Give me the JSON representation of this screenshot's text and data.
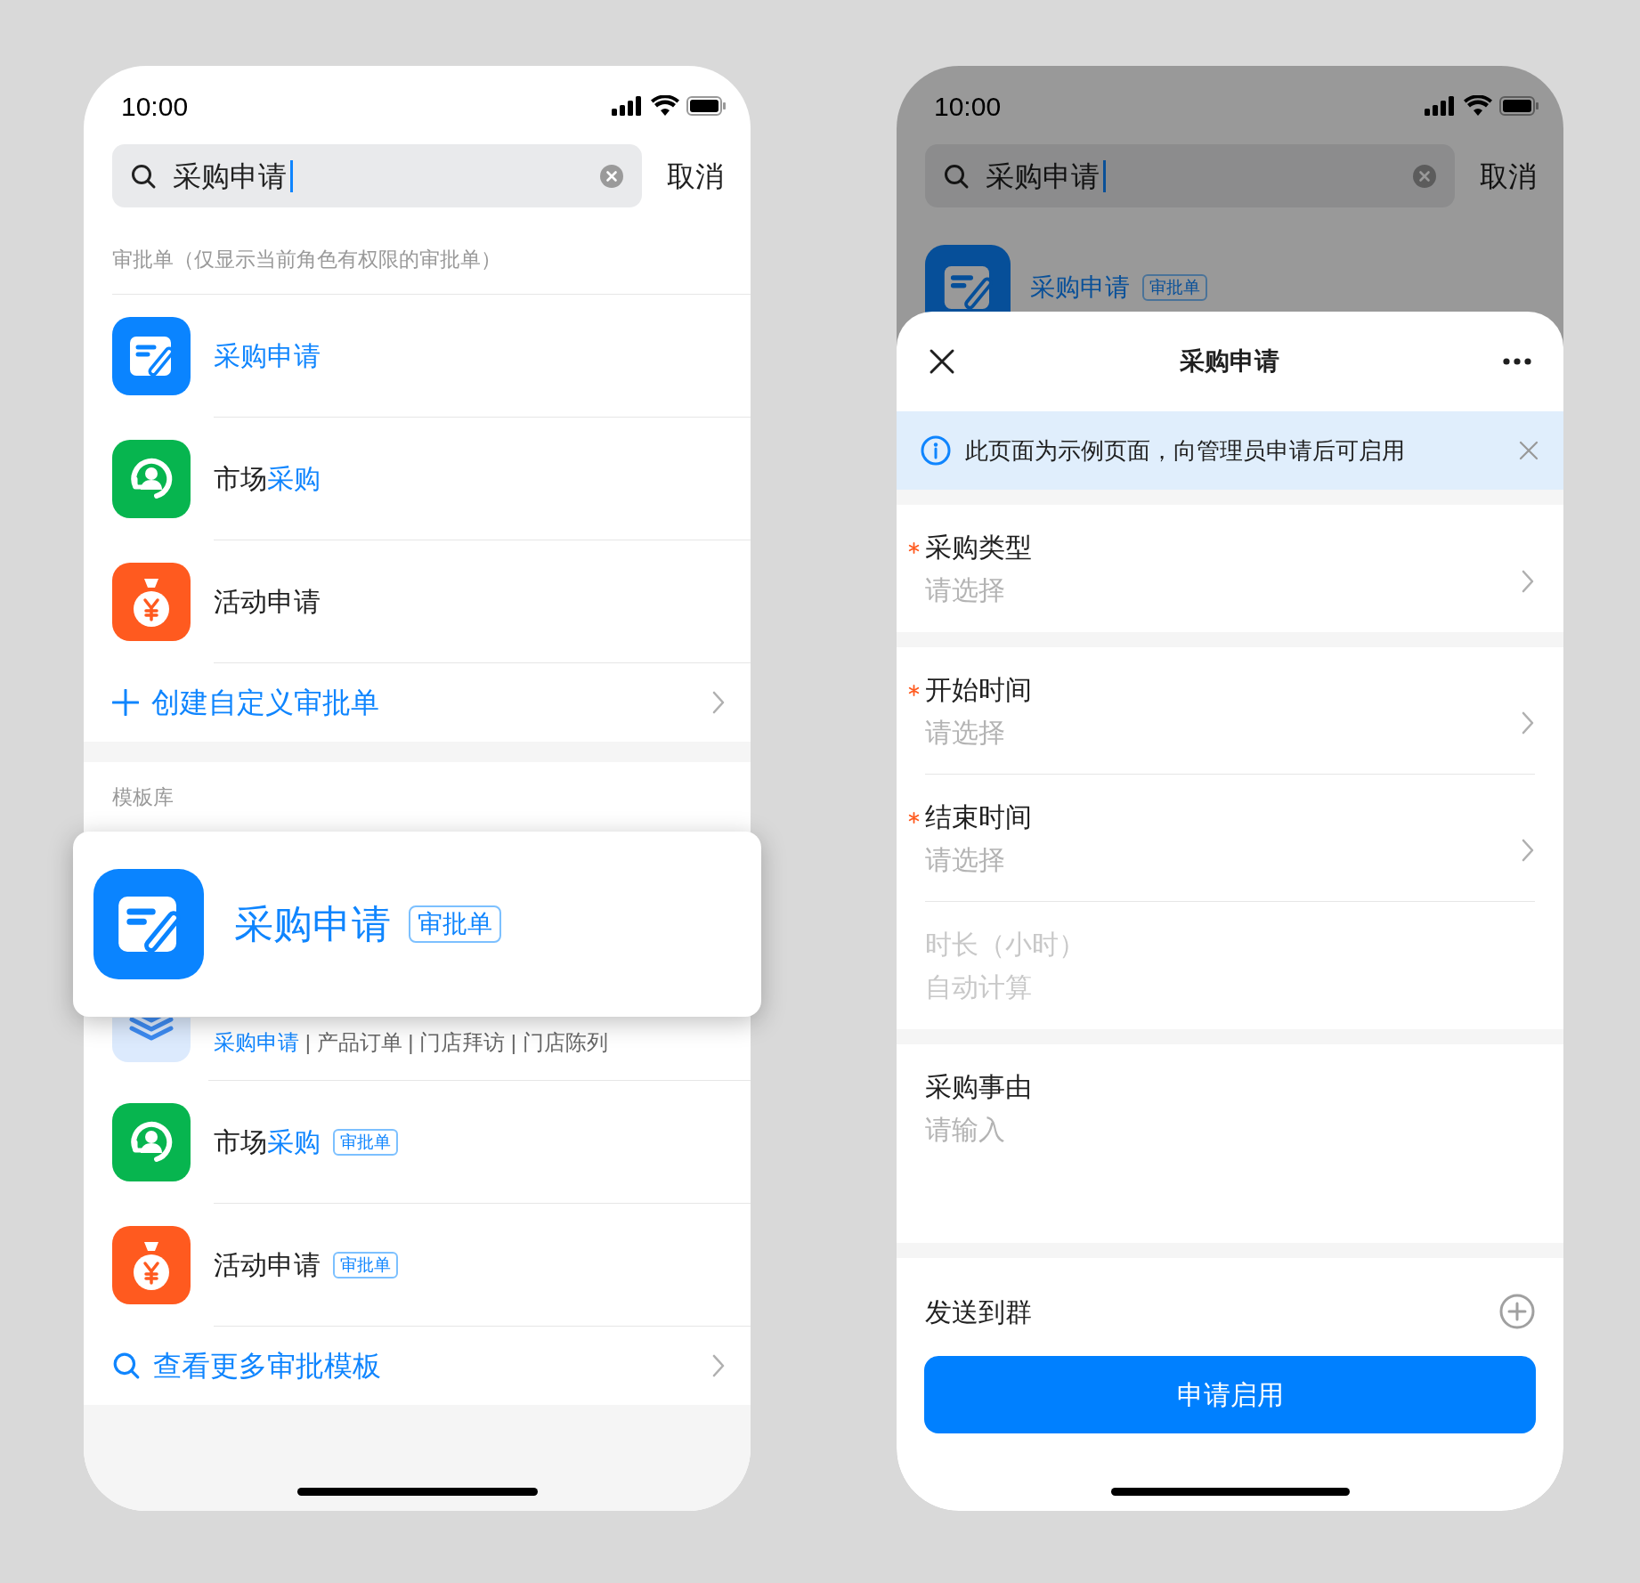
{
  "search_screen": {
    "status_bar": {
      "time": "10:00"
    },
    "search": {
      "value": "采购申请",
      "cancel": "取消"
    },
    "approvals": {
      "header": "审批单（仅显示当前角色有权限的审批单）",
      "items": [
        {
          "kind": "form",
          "title": [
            {
              "text": "采购申请",
              "highlight": true
            }
          ]
        },
        {
          "kind": "person",
          "title": [
            {
              "text": "市场",
              "highlight": false
            },
            {
              "text": "采购",
              "highlight": true
            }
          ]
        },
        {
          "kind": "money",
          "title": [
            {
              "text": "活动申请",
              "highlight": false
            }
          ]
        }
      ],
      "create_link": "创建自定义审批单"
    },
    "templates": {
      "header": "模板库",
      "items": [
        {
          "kind": "layers",
          "subtitle": [
            {
              "text": "采购申请",
              "highlight": true
            },
            {
              "text": " | 产品订单 | 门店拜访 | 门店陈列",
              "highlight": false
            }
          ]
        },
        {
          "kind": "person",
          "title": [
            {
              "text": "市场",
              "highlight": false
            },
            {
              "text": "采购",
              "highlight": true
            }
          ],
          "badge": "审批单"
        },
        {
          "kind": "money",
          "title": [
            {
              "text": "活动申请",
              "highlight": false
            }
          ],
          "badge": "审批单"
        }
      ],
      "more_link": "查看更多审批模板"
    },
    "popup": {
      "kind": "form",
      "title": "采购申请",
      "badge": "审批单"
    }
  },
  "form_screen": {
    "status_bar": {
      "time": "10:00"
    },
    "search": {
      "value": "采购申请",
      "cancel": "取消"
    },
    "result": {
      "kind": "form",
      "title": "采购申请",
      "badge": "审批单"
    },
    "sheet": {
      "title": "采购申请",
      "notice": "此页面为示例页面，向管理员申请后可启用",
      "sections": [
        {
          "fields": [
            {
              "kind": "select",
              "required": true,
              "label": "采购类型",
              "placeholder": "请选择"
            }
          ]
        },
        {
          "fields": [
            {
              "kind": "select",
              "required": true,
              "label": "开始时间",
              "placeholder": "请选择"
            },
            {
              "kind": "select",
              "required": true,
              "label": "结束时间",
              "placeholder": "请选择"
            },
            {
              "kind": "readonly",
              "required": false,
              "label": "时长（小时）",
              "placeholder": "自动计算"
            }
          ]
        },
        {
          "fields": [
            {
              "kind": "textarea",
              "required": false,
              "label": "采购事由",
              "placeholder": "请输入"
            }
          ]
        }
      ],
      "send_label": "发送到群",
      "submit": "申请启用"
    }
  }
}
